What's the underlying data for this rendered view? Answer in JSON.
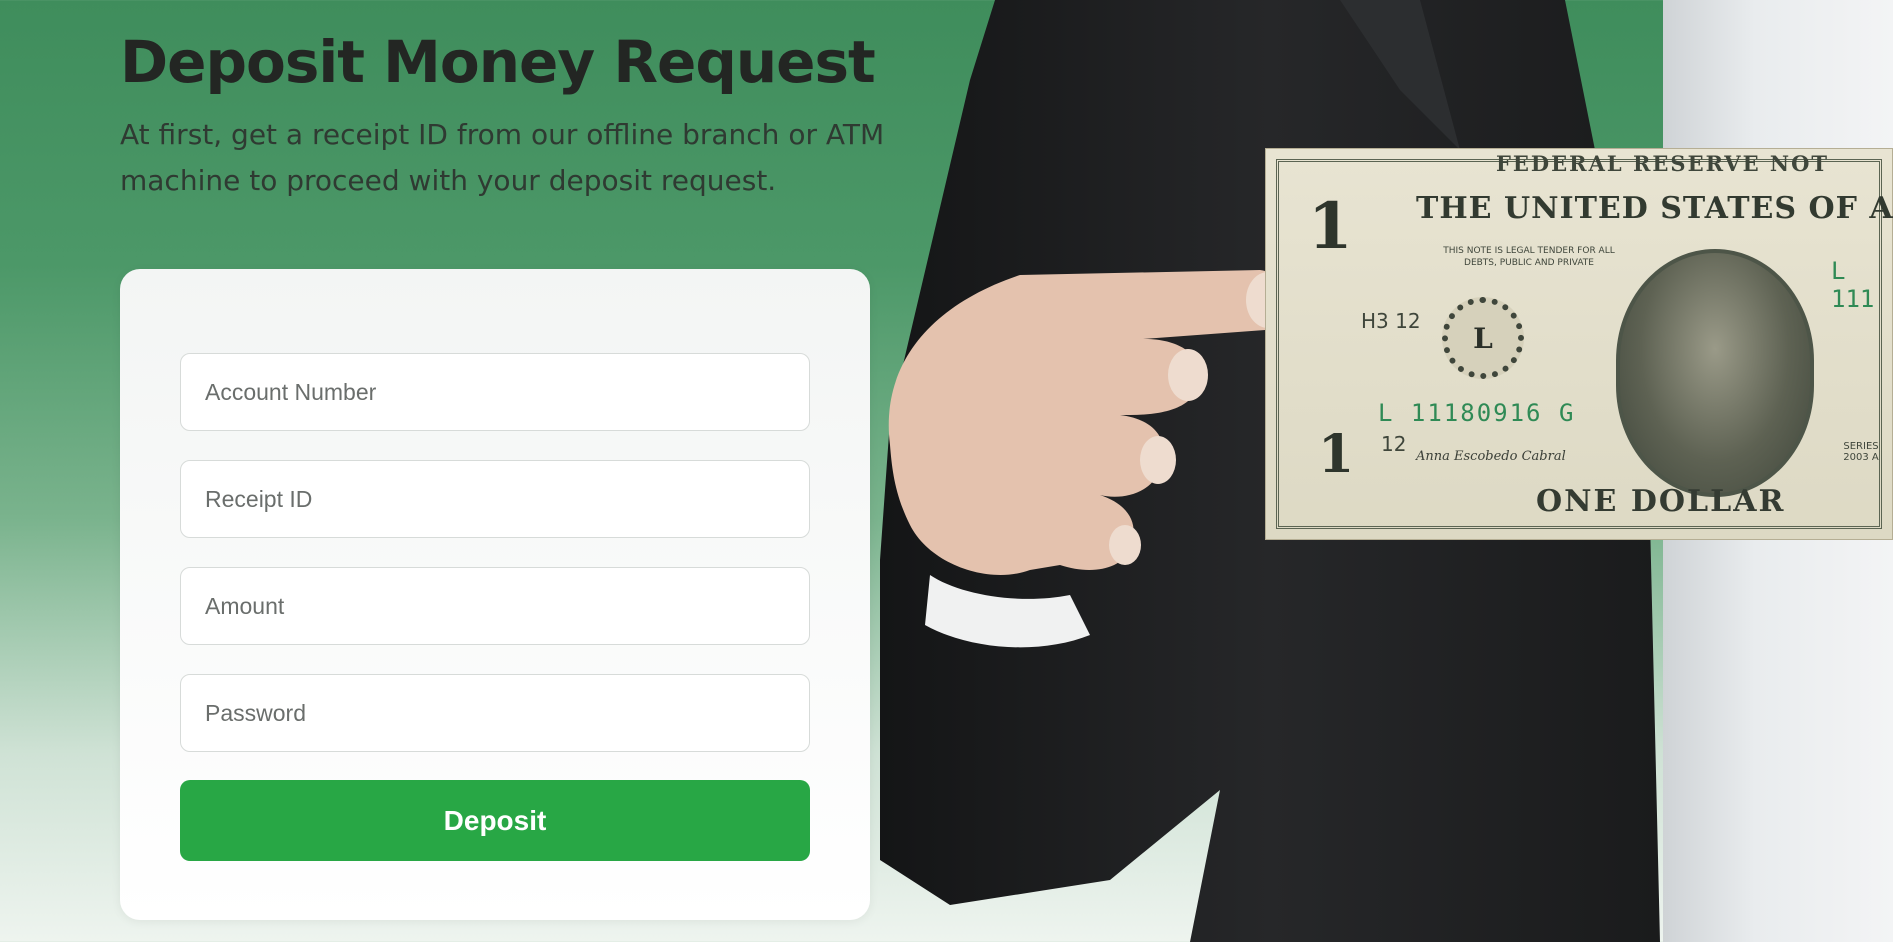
{
  "header": {
    "title": "Deposit Money Request",
    "subtitle": "At first, get a receipt ID from our offline branch or ATM machine to proceed with your deposit request."
  },
  "form": {
    "account_number_placeholder": "Account Number",
    "receipt_id_placeholder": "Receipt ID",
    "amount_placeholder": "Amount",
    "password_placeholder": "Password",
    "submit_label": "Deposit"
  },
  "hero_image": {
    "header_text": "FEDERAL RESERVE NOT",
    "title_text": "THE UNITED STATES OF AM",
    "legal_tender_text": "THIS NOTE IS LEGAL TENDER FOR ALL DEBTS, PUBLIC AND PRIVATE",
    "serial_number": "L 11180916 G",
    "serial_number_right": "L 111",
    "seal_letter": "L",
    "plate_code": "H3 12",
    "plate_number": "12",
    "signature": "Anna Escobedo Cabral",
    "denomination_text": "ONE DOLLAR",
    "corner_value": "1",
    "series_text": "SERIES 2003 A",
    "colors": {
      "suit": "#1e1f21",
      "skin": "#e4c2ae",
      "bill": "#e0dcc7",
      "serial_green": "#2f8a55"
    }
  },
  "colors": {
    "accent": "#28a745",
    "background_green": "#3f8d5c",
    "title_text": "#232623"
  }
}
